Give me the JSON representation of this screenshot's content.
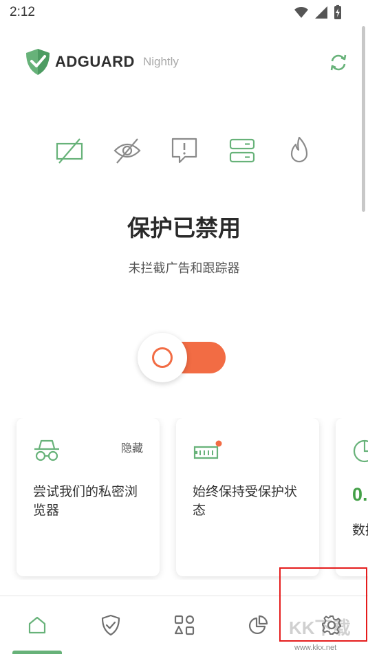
{
  "status_bar": {
    "time": "2:12",
    "icons": [
      "wifi-icon",
      "signal-icon",
      "battery-charging-icon"
    ]
  },
  "header": {
    "logo_text": "ADGUARD",
    "subtitle": "Nightly",
    "brand_color": "#67b279",
    "refresh_icon": "sync-icon"
  },
  "features": [
    {
      "name": "ad-blocking",
      "icon": "ad-block-icon",
      "enabled": true
    },
    {
      "name": "tracking-protection",
      "icon": "eye-off-icon",
      "enabled": false
    },
    {
      "name": "annoyance-blocking",
      "icon": "alert-message-icon",
      "enabled": false
    },
    {
      "name": "dns-protection",
      "icon": "server-icon",
      "enabled": true
    },
    {
      "name": "firewall",
      "icon": "flame-icon",
      "enabled": false
    }
  ],
  "protection": {
    "title": "保护已禁用",
    "description": "未拦截广告和跟踪器",
    "toggle_on": false,
    "accent_color": "#f26c44"
  },
  "cards": [
    {
      "icon": "incognito-icon",
      "badge": "隐藏",
      "text": "尝试我们的私密浏览器"
    },
    {
      "icon": "ram-chip-icon",
      "text": "始终保持受保护状态"
    },
    {
      "icon": "pie-chart-icon",
      "value": "0.",
      "text": "数据节省"
    }
  ],
  "nav": [
    {
      "name": "home",
      "icon": "home-icon",
      "active": true
    },
    {
      "name": "protection",
      "icon": "shield-check-icon",
      "active": false
    },
    {
      "name": "apps",
      "icon": "apps-grid-icon",
      "active": false
    },
    {
      "name": "statistics",
      "icon": "pie-chart-icon",
      "active": false
    },
    {
      "name": "settings",
      "icon": "gear-icon",
      "active": false
    }
  ],
  "watermark": {
    "text": "KK下载",
    "url": "www.kkx.net"
  }
}
